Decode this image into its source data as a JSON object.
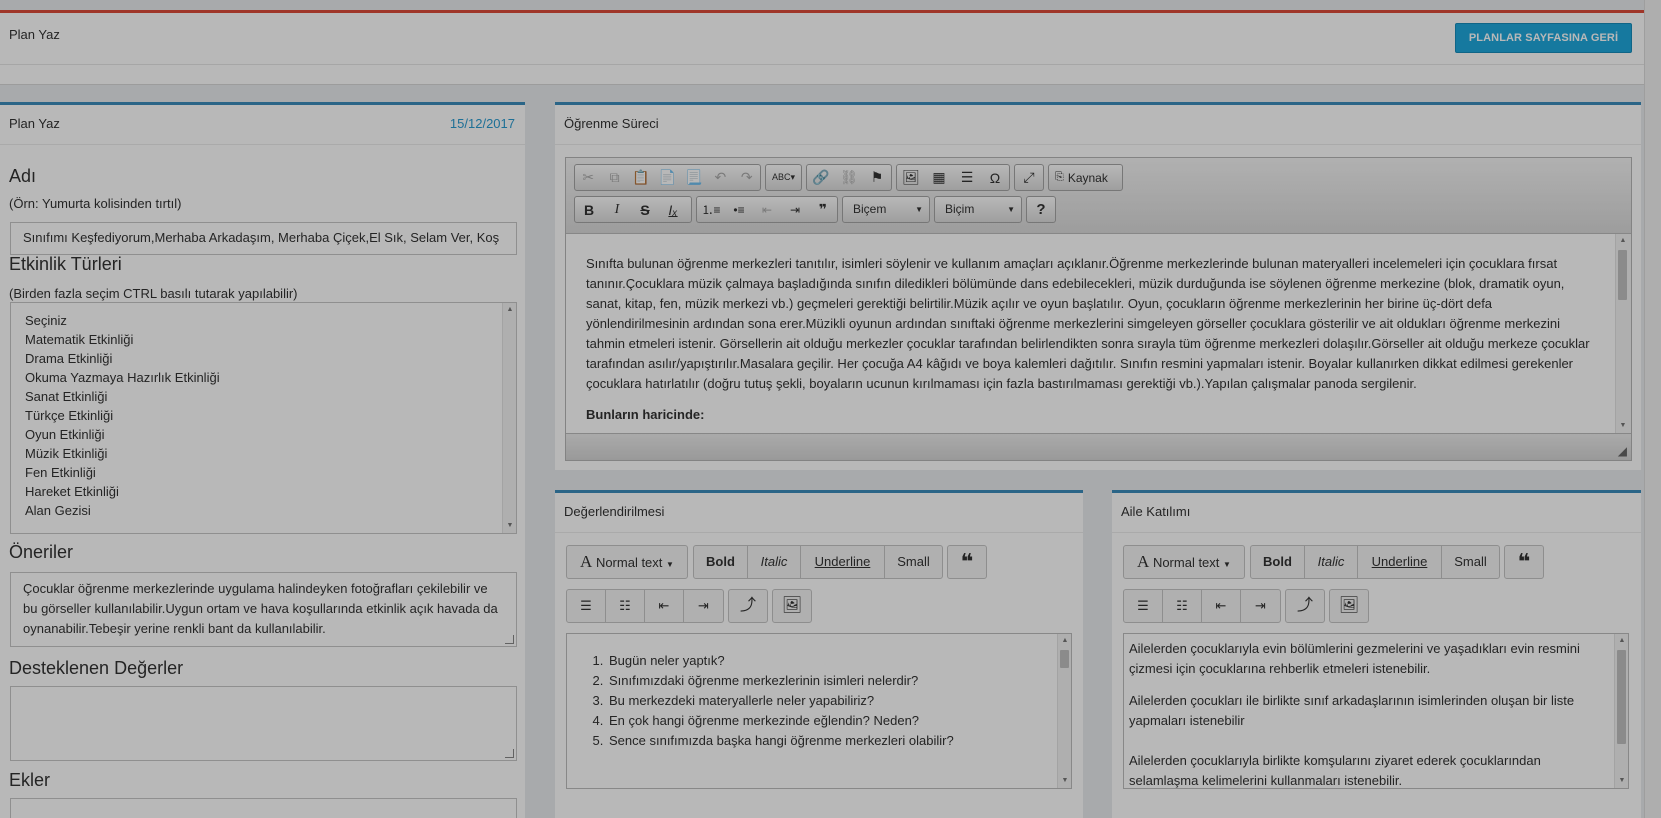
{
  "topbar": {
    "title": "Plan Yaz",
    "back_button": "PLANLAR SAYFASINA GERİ DÖN"
  },
  "left_panel": {
    "title": "Plan Yaz",
    "date": "15/12/2017",
    "name_label": "Adı",
    "name_hint": "(Örn: Yumurta kolisinden tırtıl)",
    "name_value": "Sınıfımı Keşfediyorum,Merhaba Arkadaşım, Merhaba Çiçek,El Sık, Selam Ver, Koş",
    "activity_label": "Etkinlik Türleri",
    "activity_hint": "(Birden fazla seçim CTRL basılı tutarak yapılabilir)",
    "activity_options": [
      "Seçiniz",
      "Matematik Etkinliği",
      "Drama Etkinliği",
      "Okuma Yazmaya Hazırlık Etkinliği",
      "Sanat Etkinliği",
      "Türkçe Etkinliği",
      "Oyun Etkinliği",
      "Müzik Etkinliği",
      "Fen Etkinliği",
      "Hareket Etkinliği",
      "Alan Gezisi"
    ],
    "suggestions_label": "Öneriler",
    "suggestions_value": "Çocuklar öğrenme merkezlerinde uygulama halindeyken fotoğrafları çekilebilir ve bu görseller kullanılabilir.Uygun ortam ve hava koşullarında etkinlik açık havada da oynanabilir.Tebeşir yerine renkli bant da kullanılabilir.",
    "values_label": "Desteklenen Değerler",
    "values_value": "",
    "attachments_label": "Ekler"
  },
  "learning_panel": {
    "title": "Öğrenme Süreci",
    "source_button": "Kaynak",
    "style_combo": "Biçem",
    "format_combo": "Biçim",
    "help_button": "?",
    "paragraph": "Sınıfta bulunan öğrenme merkezleri tanıtılır, isimleri söylenir ve kullanım amaçları açıklanır.Öğrenme merkezlerinde bulunan materyalleri incelemeleri için çocuklara fırsat tanınır.Çocuklara müzik çalmaya başladığında sınıfın diledikleri bölümünde dans edebilecekleri, müzik durduğunda ise söylenen öğrenme merkezine (blok, dramatik oyun, sanat, kitap, fen, müzik merkezi vb.) geçmeleri gerektiği belirtilir.Müzik açılır ve oyun başlatılır. Oyun, çocukların öğrenme merkezlerinin her birine üç-dört defa yönlendirilmesinin ardından sona erer.Müzikli oyunun ardından sınıftaki öğrenme merkezlerini simgeleyen görseller çocuklara gösterilir ve ait oldukları öğrenme merkezini tahmin etmeleri istenir. Görsellerin ait olduğu merkezler çocuklar tarafından belirlendikten sonra sırayla tüm öğrenme merkezleri dolaşılır.Görseller ait olduğu merkeze çocuklar tarafından asılır/yapıştırılır.Masalara geçilir. Her çocuğa A4 kâğıdı ve boya kalemleri dağıtılır. Sınıfın resmini yapmaları istenir. Boyalar kullanırken dikkat edilmesi gerekenler çocuklara hatırlatılır (doğru tutuş şekli, boyaların ucunun kırılmaması için fazla bastırılmaması gerektiği vb.).Yapılan çalışmalar panoda sergilenir.",
    "bold_line": "Bunların haricinde:"
  },
  "evaluation_panel": {
    "title": "Değerlendirilmesi",
    "normal_text": "Normal text",
    "bold": "Bold",
    "italic": "Italic",
    "underline": "Underline",
    "small": "Small",
    "questions": [
      "Bugün neler yaptık?",
      "Sınıfımızdaki öğrenme merkezlerinin isimleri nelerdir?",
      "Bu merkezdeki materyallerle neler yapabiliriz?",
      "En çok hangi öğrenme merkezinde eğlendin? Neden?",
      "Sence sınıfımızda başka hangi öğrenme merkezleri olabilir?"
    ]
  },
  "family_panel": {
    "title": "Aile Katılımı",
    "normal_text": "Normal text",
    "bold": "Bold",
    "italic": "Italic",
    "underline": "Underline",
    "small": "Small",
    "paragraphs": [
      " Ailelerden çocuklarıyla evin bölümlerini gezmelerini ve yaşadıkları evin resmini çizmesi için çocuklarına rehberlik etmeleri istenebilir.",
      "Ailelerden çocukları ile birlikte sınıf arkadaşlarının isimlerinden oluşan bir liste yapmaları istenebilir",
      " Ailelerden çocuklarıyla birlikte komşularını ziyaret ederek çocuklarından selamlaşma kelimelerini kullanmaları istenebilir."
    ]
  },
  "colors": {
    "accent_blue": "#3c8dbc",
    "top_red": "#dd4b39",
    "button_blue": "#1fa8dd",
    "date_blue": "#2a9bd0"
  }
}
